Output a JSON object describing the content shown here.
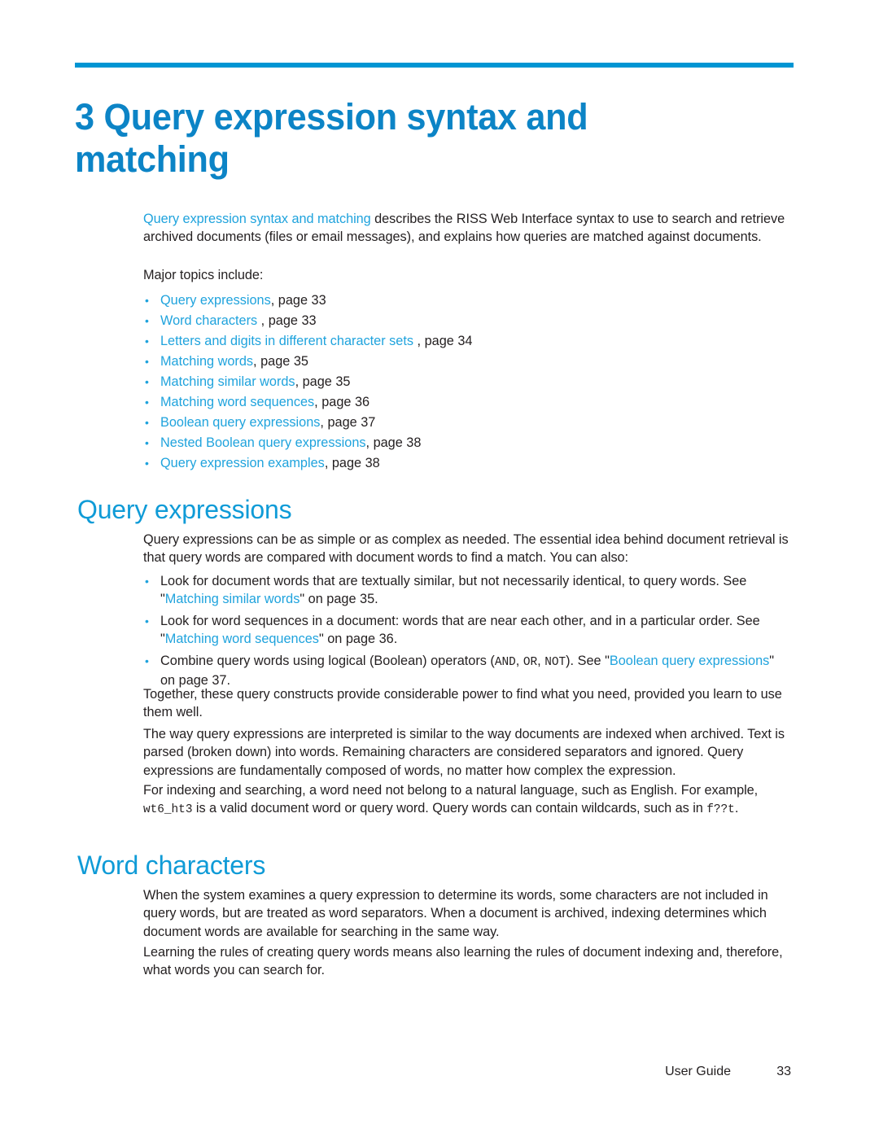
{
  "theme": {
    "rule_color": "#0095d3",
    "chapter_title_color": "#0c84c6",
    "section_heading_color": "#0f9bd7",
    "link_color": "#1fa3dd",
    "body_color": "#231f20",
    "page_background": "#ffffff"
  },
  "chapter": {
    "number": "3",
    "title": "3 Query expression syntax and matching"
  },
  "intro": {
    "link_text": "Query expression syntax and matching",
    "rest": " describes the RISS Web Interface syntax to use to search and retrieve archived documents (files or email messages), and explains how queries are matched against documents.",
    "topics_lead": "Major topics include:"
  },
  "topics": [
    {
      "link": "Query expressions",
      "tail": ", page 33"
    },
    {
      "link": "Word characters",
      "tail": " , page 33"
    },
    {
      "link": "Letters and digits in different character sets",
      "tail": " , page 34"
    },
    {
      "link": "Matching words",
      "tail": ", page 35"
    },
    {
      "link": "Matching similar words",
      "tail": ", page 35"
    },
    {
      "link": "Matching word sequences",
      "tail": ", page 36"
    },
    {
      "link": "Boolean query expressions",
      "tail": ", page 37"
    },
    {
      "link": "Nested Boolean query expressions",
      "tail": ", page 38"
    },
    {
      "link": "Query expression examples",
      "tail": ", page 38"
    }
  ],
  "section_query_expressions": {
    "heading": "Query expressions",
    "intro": "Query expressions can be as simple or as complex as needed.  The essential idea behind document retrieval is that query words are compared with document words to find a match.  You can also:",
    "bullet1_pre": "Look for document words that are textually similar, but not necessarily identical, to query words.  See \"",
    "bullet1_link": "Matching similar words",
    "bullet1_post": "\" on page 35.",
    "bullet2_pre": "Look for word sequences in a document:  words that are near each other, and in a particular order.  See \"",
    "bullet2_link": "Matching word sequences",
    "bullet2_post": "\" on page 36.",
    "bullet3_pre": "Combine query words using logical (Boolean) operators (",
    "bullet3_op1": "AND",
    "bullet3_sep1": ", ",
    "bullet3_op2": "OR",
    "bullet3_sep2": ", ",
    "bullet3_op3": "NOT",
    "bullet3_mid": ").  See \"",
    "bullet3_link": "Boolean query expressions",
    "bullet3_post": "\" on page 37.",
    "para_together": "Together, these query constructs provide considerable power to find what you need, provided you learn to use them well.",
    "para_way": "The way query expressions are interpreted is similar to the way documents are indexed when archived.  Text is parsed (broken down) into words.  Remaining characters are considered separators and ignored.  Query expressions are fundamentally composed of words, no matter how complex the expression.",
    "para_indexing_pre": "For indexing and searching, a word need not belong to a natural language, such as English.  For example, ",
    "para_indexing_code1": "wt6_ht3",
    "para_indexing_mid": " is a valid document word or query word.  Query words can contain wildcards, such as in ",
    "para_indexing_code2": "f??t",
    "para_indexing_post": "."
  },
  "section_word_characters": {
    "heading": "Word characters",
    "para1": "When the system examines a query expression to determine its words, some characters are not included in query words, but are treated as word separators.  When a document is archived, indexing determines which document words are available for searching in the same way.",
    "para2": "Learning the rules of creating query words means also learning the rules of document indexing and, therefore, what words you can search for."
  },
  "footer": {
    "label": "User Guide",
    "page_number": "33"
  }
}
